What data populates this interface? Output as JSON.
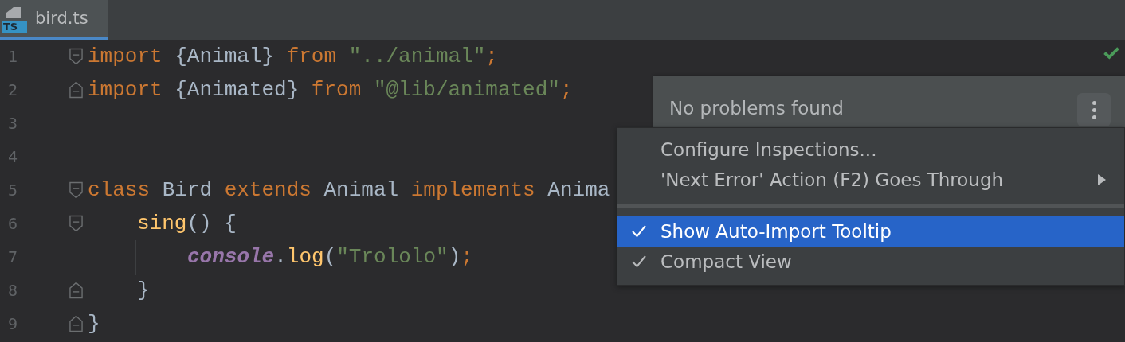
{
  "tab": {
    "label": "bird.ts",
    "selected": true,
    "file_icon": "TS"
  },
  "lines": [
    {
      "number": "1",
      "fold_start": true,
      "tokens": [
        {
          "kind": "kw",
          "text": "import "
        },
        {
          "kind": "id",
          "text": "{Animal} "
        },
        {
          "kind": "kw",
          "text": "from "
        },
        {
          "kind": "str",
          "text": "\"../animal\""
        },
        {
          "kind": "kw",
          "text": ";"
        }
      ]
    },
    {
      "number": "2",
      "fold_end": true,
      "tokens": [
        {
          "kind": "kw",
          "text": "import "
        },
        {
          "kind": "id",
          "text": "{Animated} "
        },
        {
          "kind": "kw",
          "text": "from "
        },
        {
          "kind": "str",
          "text": "\"@lib/animated\""
        },
        {
          "kind": "kw",
          "text": ";"
        }
      ]
    },
    {
      "number": "3"
    },
    {
      "number": "4"
    },
    {
      "number": "5",
      "fold_start": true,
      "tokens": [
        {
          "kind": "kw",
          "text": "class "
        },
        {
          "kind": "id",
          "text": "Bird "
        },
        {
          "kind": "kw",
          "text": "extends "
        },
        {
          "kind": "id",
          "text": "Animal "
        },
        {
          "kind": "kw",
          "text": "implements "
        },
        {
          "kind": "id",
          "text": "Anima"
        }
      ]
    },
    {
      "number": "6",
      "fold_start": true,
      "in_class": true,
      "tokens": [
        {
          "kind": "fn",
          "text": "sing"
        },
        {
          "kind": "id",
          "text": "() {"
        }
      ]
    },
    {
      "number": "7",
      "in_class": true,
      "in_method": true,
      "tokens": [
        {
          "kind": "obj",
          "text": "console"
        },
        {
          "kind": "id",
          "text": "."
        },
        {
          "kind": "fn",
          "text": "log"
        },
        {
          "kind": "id",
          "text": "("
        },
        {
          "kind": "str",
          "text": "\"Trololo\""
        },
        {
          "kind": "id",
          "text": ")"
        },
        {
          "kind": "kw",
          "text": ";"
        }
      ]
    },
    {
      "number": "8",
      "fold_end": true,
      "in_class": true,
      "tokens": [
        {
          "kind": "id",
          "text": "}"
        }
      ]
    },
    {
      "number": "9",
      "fold_end": true,
      "tokens": [
        {
          "kind": "id",
          "text": "}"
        }
      ]
    }
  ],
  "problems_panel": {
    "message": "No problems found"
  },
  "menu": [
    {
      "kind": "action",
      "label": "Configure Inspections...",
      "selected": false
    },
    {
      "kind": "submenu",
      "label": "'Next Error' Action (F2) Goes Through",
      "selected": false
    },
    {
      "kind": "separator"
    },
    {
      "kind": "toggle",
      "label": "Show Auto-Import Tooltip",
      "checked": true,
      "selected": true
    },
    {
      "kind": "toggle",
      "label": "Compact View",
      "checked": true,
      "selected": false
    }
  ]
}
